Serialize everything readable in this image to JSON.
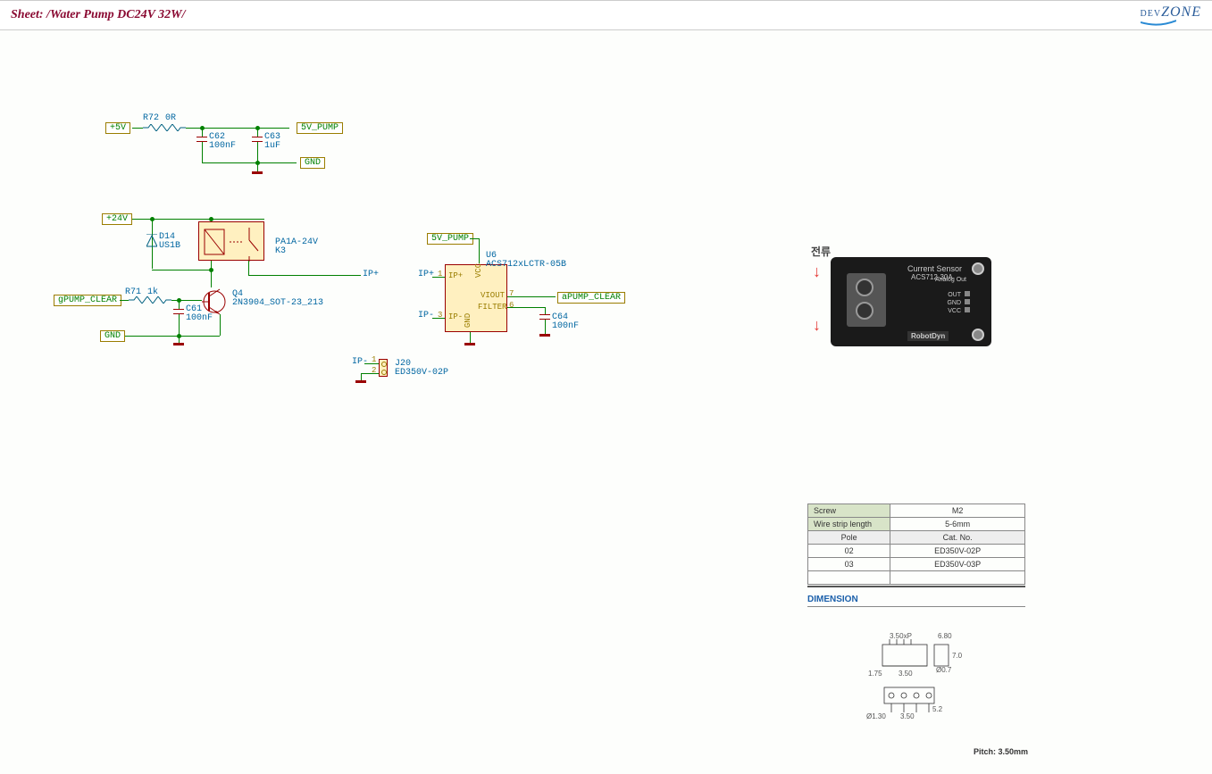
{
  "header": {
    "title": "Sheet: /Water Pump DC24V 32W/",
    "logo_small": "DEV",
    "logo_big": "ZONE"
  },
  "power_labels": {
    "p5v": "+5V",
    "p5v_pump_top": "5V_PUMP",
    "gnd_top": "GND",
    "p24v": "+24V",
    "gnd_mid": "GND",
    "p5v_pump_chip": "5V_PUMP"
  },
  "net_labels": {
    "gpump": "gPUMP_CLEAR",
    "apump": "aPUMP_CLEAR",
    "ip_plus_out": "IP+",
    "ip_plus_in": "IP+",
    "ip_minus_in": "IP-",
    "ip_minus_conn": "IP-"
  },
  "components": {
    "r72": {
      "ref": "R72",
      "val": "0R"
    },
    "c62": {
      "ref": "C62",
      "val": "100nF"
    },
    "c63": {
      "ref": "C63",
      "val": "1uF"
    },
    "d14": {
      "ref": "D14",
      "val": "US1B"
    },
    "k3": {
      "ref": "PA1A-24V",
      "val": "K3"
    },
    "r71": {
      "ref": "R71",
      "val": "1k"
    },
    "c61": {
      "ref": "C61",
      "val": "100nF"
    },
    "q4": {
      "ref": "Q4",
      "val": "2N3904_SOT-23_213"
    },
    "u6": {
      "ref": "U6",
      "val": "ACS712xLCTR-05B"
    },
    "c64": {
      "ref": "C64",
      "val": "100nF"
    },
    "j20": {
      "ref": "J20",
      "val": "ED350V-02P"
    }
  },
  "pins": {
    "u6_vcc": "VCC",
    "u6_viout": "VIOUT",
    "u6_filter": "FILTER",
    "u6_gnd": "GND",
    "u6_ipplus": "IP+",
    "u6_ipminus": "IP-",
    "u6_p1": "1",
    "u6_p3": "3",
    "u6_p6": "6",
    "u6_p7": "7",
    "j20_p1": "1",
    "j20_p2": "2"
  },
  "side": {
    "korean": "전류",
    "sensor_title": "Current Sensor",
    "sensor_part": "ACS712-30A",
    "sensor_pins": [
      "OUT",
      "GND",
      "VCC"
    ],
    "analog_out": "Analog Out",
    "brand": "RobotDyn",
    "dimension_heading": "DIMENSION",
    "pitch": "Pitch: 3.50mm",
    "dims": {
      "a": "3.50xP",
      "b": "6.80",
      "c": "1.75",
      "d": "3.50",
      "e": "Ø0.7",
      "f": "Ø1.30",
      "g": "7.0",
      "h": "5.2"
    }
  },
  "table": {
    "r1_a": "Screw",
    "r1_b": "M2",
    "r2_a": "Wire strip length",
    "r2_b": "5-6mm",
    "r3_a": "Pole",
    "r3_b": "Cat. No.",
    "r4_a": "02",
    "r4_b": "ED350V-02P",
    "r5_a": "03",
    "r5_b": "ED350V-03P"
  }
}
